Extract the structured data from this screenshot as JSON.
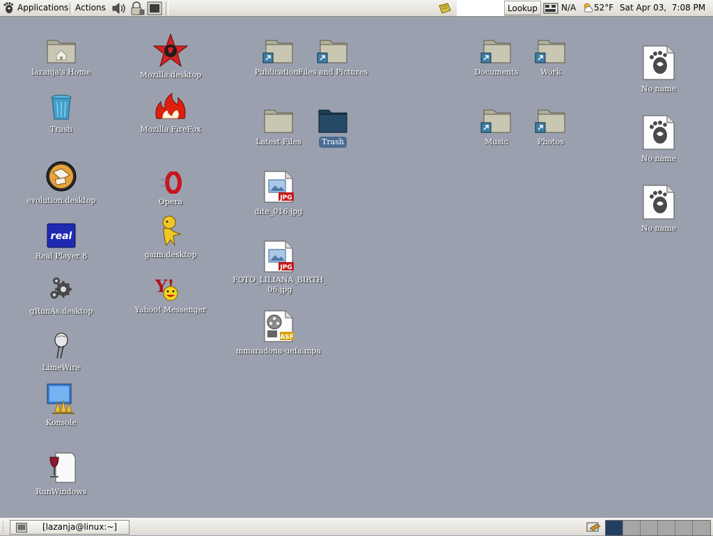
{
  "top_panel": {
    "menus": {
      "applications": "Applications",
      "actions": "Actions"
    },
    "lookup_label": "Lookup",
    "network_status": "N/A",
    "weather": "52°F",
    "clock": "Sat Apr 03,  7:08 PM"
  },
  "desktop": {
    "icons": [
      {
        "label": "lazanja's Home",
        "icon": "home-folder-icon"
      },
      {
        "label": "Trash",
        "icon": "trash-can-icon"
      },
      {
        "label": "evolution.desktop",
        "icon": "evolution-icon"
      },
      {
        "label": "Real Player 8",
        "icon": "realplayer-icon"
      },
      {
        "label": "gRunAs.desktop",
        "icon": "gears-icon"
      },
      {
        "label": "LimeWire",
        "icon": "limewire-icon"
      },
      {
        "label": "Konsole",
        "icon": "konsole-icon"
      },
      {
        "label": "RunWindows",
        "icon": "wine-icon"
      },
      {
        "label": "Mozilla.desktop",
        "icon": "mozilla-icon"
      },
      {
        "label": "Mozilla FireFox",
        "icon": "firefox-icon"
      },
      {
        "label": "Opera",
        "icon": "opera-icon"
      },
      {
        "label": "gaim.desktop",
        "icon": "gaim-icon"
      },
      {
        "label": "Yahoo! Messenger",
        "icon": "yahoo-messenger-icon"
      },
      {
        "label": "Publications",
        "icon": "folder-link-icon"
      },
      {
        "label": "Files and Pictures",
        "icon": "folder-link-icon"
      },
      {
        "label": "Latest Files",
        "icon": "folder-icon"
      },
      {
        "label": "Trash",
        "icon": "folder-dark-icon",
        "selected": true
      },
      {
        "label": "dite_016.jpg",
        "icon": "jpg-file-icon"
      },
      {
        "label": "FOTO_LILIANA_BIRTH_06.jpg",
        "icon": "jpg-file-icon"
      },
      {
        "label": "mmaradona-uefa.mpa",
        "icon": "asf-video-file-icon"
      },
      {
        "label": "Documents",
        "icon": "folder-link-icon"
      },
      {
        "label": "Work",
        "icon": "folder-link-icon"
      },
      {
        "label": "Music",
        "icon": "folder-link-icon"
      },
      {
        "label": "Photos",
        "icon": "folder-link-icon"
      },
      {
        "label": "No name",
        "icon": "gnome-foot-file-icon"
      },
      {
        "label": "No name",
        "icon": "gnome-foot-file-icon"
      },
      {
        "label": "No name",
        "icon": "gnome-foot-file-icon"
      }
    ]
  },
  "bottom_panel": {
    "task_label": "[lazanja@linux:~]",
    "workspaces": 6,
    "active_workspace": 1
  },
  "colors": {
    "desktop_background": "#9aa0ae",
    "selection": "#4a6c94",
    "active_workspace": "#223f63"
  }
}
